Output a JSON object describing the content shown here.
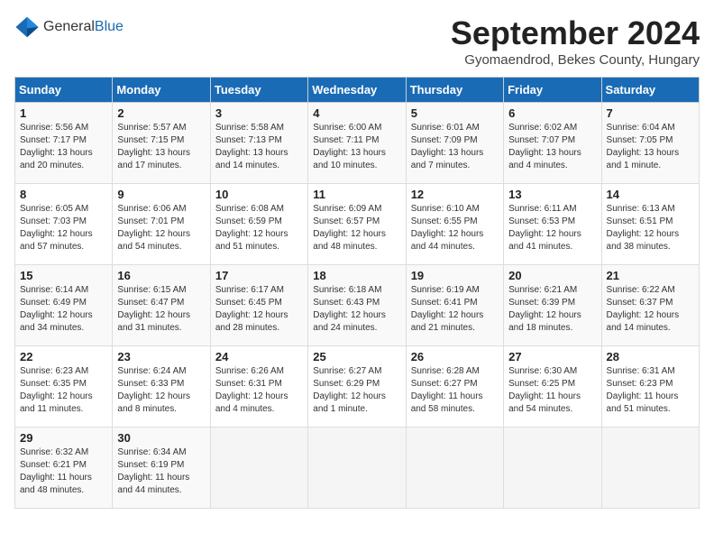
{
  "header": {
    "logo_general": "General",
    "logo_blue": "Blue",
    "month_title": "September 2024",
    "subtitle": "Gyomaendrod, Bekes County, Hungary"
  },
  "columns": [
    "Sunday",
    "Monday",
    "Tuesday",
    "Wednesday",
    "Thursday",
    "Friday",
    "Saturday"
  ],
  "weeks": [
    [
      {
        "day": "1",
        "info": "Sunrise: 5:56 AM\nSunset: 7:17 PM\nDaylight: 13 hours and 20 minutes."
      },
      {
        "day": "2",
        "info": "Sunrise: 5:57 AM\nSunset: 7:15 PM\nDaylight: 13 hours and 17 minutes."
      },
      {
        "day": "3",
        "info": "Sunrise: 5:58 AM\nSunset: 7:13 PM\nDaylight: 13 hours and 14 minutes."
      },
      {
        "day": "4",
        "info": "Sunrise: 6:00 AM\nSunset: 7:11 PM\nDaylight: 13 hours and 10 minutes."
      },
      {
        "day": "5",
        "info": "Sunrise: 6:01 AM\nSunset: 7:09 PM\nDaylight: 13 hours and 7 minutes."
      },
      {
        "day": "6",
        "info": "Sunrise: 6:02 AM\nSunset: 7:07 PM\nDaylight: 13 hours and 4 minutes."
      },
      {
        "day": "7",
        "info": "Sunrise: 6:04 AM\nSunset: 7:05 PM\nDaylight: 13 hours and 1 minute."
      }
    ],
    [
      {
        "day": "8",
        "info": "Sunrise: 6:05 AM\nSunset: 7:03 PM\nDaylight: 12 hours and 57 minutes."
      },
      {
        "day": "9",
        "info": "Sunrise: 6:06 AM\nSunset: 7:01 PM\nDaylight: 12 hours and 54 minutes."
      },
      {
        "day": "10",
        "info": "Sunrise: 6:08 AM\nSunset: 6:59 PM\nDaylight: 12 hours and 51 minutes."
      },
      {
        "day": "11",
        "info": "Sunrise: 6:09 AM\nSunset: 6:57 PM\nDaylight: 12 hours and 48 minutes."
      },
      {
        "day": "12",
        "info": "Sunrise: 6:10 AM\nSunset: 6:55 PM\nDaylight: 12 hours and 44 minutes."
      },
      {
        "day": "13",
        "info": "Sunrise: 6:11 AM\nSunset: 6:53 PM\nDaylight: 12 hours and 41 minutes."
      },
      {
        "day": "14",
        "info": "Sunrise: 6:13 AM\nSunset: 6:51 PM\nDaylight: 12 hours and 38 minutes."
      }
    ],
    [
      {
        "day": "15",
        "info": "Sunrise: 6:14 AM\nSunset: 6:49 PM\nDaylight: 12 hours and 34 minutes."
      },
      {
        "day": "16",
        "info": "Sunrise: 6:15 AM\nSunset: 6:47 PM\nDaylight: 12 hours and 31 minutes."
      },
      {
        "day": "17",
        "info": "Sunrise: 6:17 AM\nSunset: 6:45 PM\nDaylight: 12 hours and 28 minutes."
      },
      {
        "day": "18",
        "info": "Sunrise: 6:18 AM\nSunset: 6:43 PM\nDaylight: 12 hours and 24 minutes."
      },
      {
        "day": "19",
        "info": "Sunrise: 6:19 AM\nSunset: 6:41 PM\nDaylight: 12 hours and 21 minutes."
      },
      {
        "day": "20",
        "info": "Sunrise: 6:21 AM\nSunset: 6:39 PM\nDaylight: 12 hours and 18 minutes."
      },
      {
        "day": "21",
        "info": "Sunrise: 6:22 AM\nSunset: 6:37 PM\nDaylight: 12 hours and 14 minutes."
      }
    ],
    [
      {
        "day": "22",
        "info": "Sunrise: 6:23 AM\nSunset: 6:35 PM\nDaylight: 12 hours and 11 minutes."
      },
      {
        "day": "23",
        "info": "Sunrise: 6:24 AM\nSunset: 6:33 PM\nDaylight: 12 hours and 8 minutes."
      },
      {
        "day": "24",
        "info": "Sunrise: 6:26 AM\nSunset: 6:31 PM\nDaylight: 12 hours and 4 minutes."
      },
      {
        "day": "25",
        "info": "Sunrise: 6:27 AM\nSunset: 6:29 PM\nDaylight: 12 hours and 1 minute."
      },
      {
        "day": "26",
        "info": "Sunrise: 6:28 AM\nSunset: 6:27 PM\nDaylight: 11 hours and 58 minutes."
      },
      {
        "day": "27",
        "info": "Sunrise: 6:30 AM\nSunset: 6:25 PM\nDaylight: 11 hours and 54 minutes."
      },
      {
        "day": "28",
        "info": "Sunrise: 6:31 AM\nSunset: 6:23 PM\nDaylight: 11 hours and 51 minutes."
      }
    ],
    [
      {
        "day": "29",
        "info": "Sunrise: 6:32 AM\nSunset: 6:21 PM\nDaylight: 11 hours and 48 minutes."
      },
      {
        "day": "30",
        "info": "Sunrise: 6:34 AM\nSunset: 6:19 PM\nDaylight: 11 hours and 44 minutes."
      },
      {
        "day": "",
        "info": ""
      },
      {
        "day": "",
        "info": ""
      },
      {
        "day": "",
        "info": ""
      },
      {
        "day": "",
        "info": ""
      },
      {
        "day": "",
        "info": ""
      }
    ]
  ]
}
